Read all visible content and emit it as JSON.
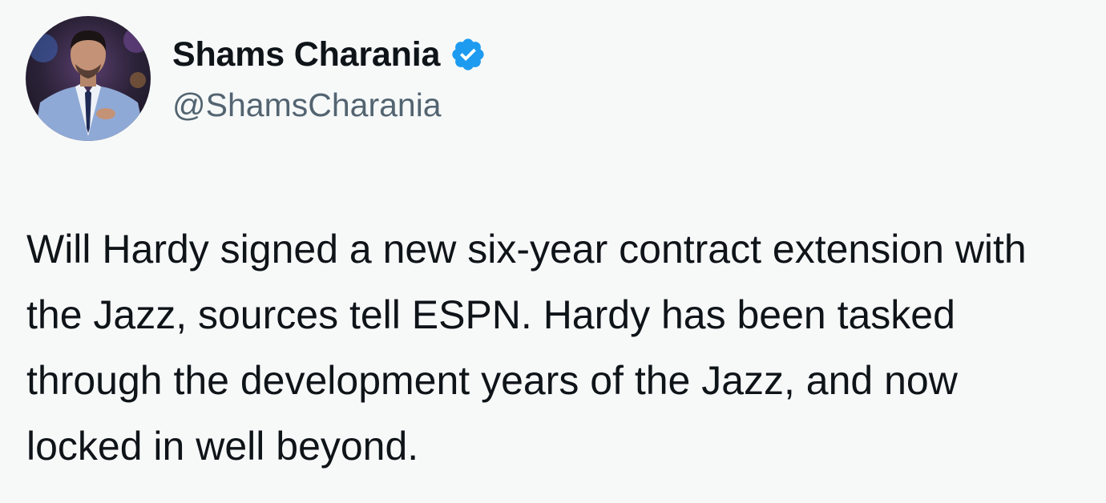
{
  "author": {
    "display_name": "Shams Charania",
    "handle": "@ShamsCharania",
    "verified": true,
    "avatar_icon": "profile-photo",
    "badge_icon": "verified-check-icon"
  },
  "tweet": {
    "text": "Will Hardy signed a new six-year contract extension with the Jazz, sources tell ESPN. Hardy has been tasked through the development years of the Jazz, and now locked in well beyond."
  },
  "colors": {
    "background": "#f7f9f9",
    "text_primary": "#0f1419",
    "text_secondary": "#536471",
    "verified_blue": "#1d9bf0"
  }
}
